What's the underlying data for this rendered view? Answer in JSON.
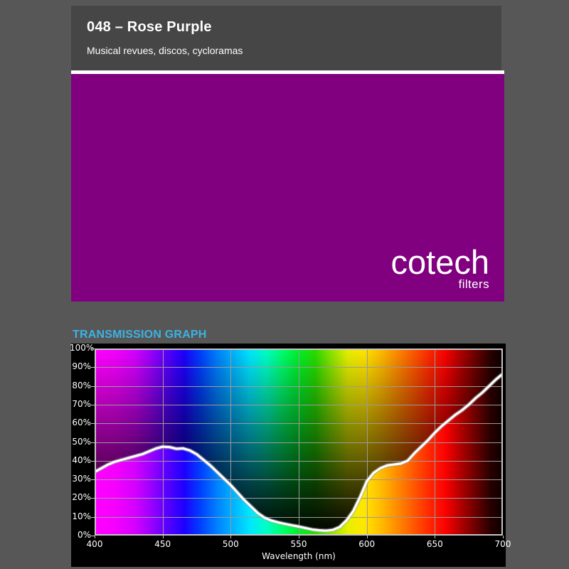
{
  "page": {
    "background": "#575757"
  },
  "header": {
    "background": "#464646",
    "title": "048 – Rose Purple",
    "subtitle": "Musical revues, discos, cycloramas"
  },
  "swatch": {
    "color": "#800080",
    "brand": "cotech",
    "brand_sub": "filters"
  },
  "section": {
    "heading": "TRANSMISSION GRAPH",
    "heading_color": "#3bb3e4"
  },
  "chart_data": {
    "type": "area",
    "title": "TRANSMISSION GRAPH",
    "xlabel": "Wavelength (nm)",
    "ylabel": "",
    "xlim": [
      400,
      700
    ],
    "ylim": [
      0,
      100
    ],
    "grid": true,
    "panel_bg": "#000000",
    "curve_color": "#ffffff",
    "grid_color": "#9b9b9b",
    "frame_color": "#c6c6c6",
    "x_ticks": [
      400,
      450,
      500,
      550,
      600,
      650,
      700
    ],
    "y_tick_values": [
      100,
      90,
      80,
      70,
      60,
      50,
      40,
      30,
      20,
      10,
      0
    ],
    "y_tick_labels": [
      "100%",
      "90%",
      "80%",
      "70%",
      "60%",
      "50%",
      "40%",
      "30%",
      "20%",
      "10%",
      "0%"
    ],
    "x": [
      400,
      405,
      410,
      415,
      420,
      425,
      430,
      435,
      440,
      445,
      450,
      455,
      460,
      465,
      470,
      475,
      480,
      485,
      490,
      495,
      500,
      505,
      510,
      515,
      520,
      525,
      530,
      535,
      540,
      545,
      550,
      555,
      560,
      565,
      570,
      575,
      580,
      585,
      590,
      595,
      600,
      605,
      610,
      615,
      620,
      625,
      630,
      635,
      640,
      645,
      650,
      655,
      660,
      665,
      670,
      675,
      680,
      685,
      690,
      695,
      700
    ],
    "transmission_percent": [
      34,
      36,
      38,
      39.5,
      40.5,
      41.5,
      42.5,
      43.5,
      45,
      46.5,
      47.5,
      47.3,
      46.4,
      46.6,
      45.5,
      43.5,
      40.5,
      37.5,
      34,
      30.5,
      27,
      23,
      19,
      15.5,
      12,
      9.5,
      8,
      7,
      6.2,
      5.5,
      4.8,
      4,
      3.2,
      2.8,
      2.6,
      3,
      4.5,
      8,
      13,
      20.5,
      29,
      33.5,
      36,
      37.5,
      38,
      38.5,
      40,
      44,
      47.5,
      51,
      55,
      58.5,
      61.5,
      64.5,
      67,
      70,
      73.5,
      76.5,
      80,
      83.5,
      86.5
    ],
    "spectrum_stops": [
      [
        0.0,
        "#ff00ff"
      ],
      [
        0.05,
        "#f600ff"
      ],
      [
        0.1,
        "#d400ff"
      ],
      [
        0.14,
        "#9900ff"
      ],
      [
        0.18,
        "#5500ff"
      ],
      [
        0.22,
        "#1c00ff"
      ],
      [
        0.26,
        "#0040ff"
      ],
      [
        0.3,
        "#0080ff"
      ],
      [
        0.34,
        "#00b4ff"
      ],
      [
        0.38,
        "#00e6ff"
      ],
      [
        0.42,
        "#00ffc8"
      ],
      [
        0.46,
        "#00ff6e"
      ],
      [
        0.5,
        "#00f02a"
      ],
      [
        0.54,
        "#28dc00"
      ],
      [
        0.58,
        "#8ce600"
      ],
      [
        0.62,
        "#e6f000"
      ],
      [
        0.66,
        "#ffe600"
      ],
      [
        0.7,
        "#ffbe00"
      ],
      [
        0.74,
        "#ff8c00"
      ],
      [
        0.78,
        "#ff5a00"
      ],
      [
        0.82,
        "#ff2800"
      ],
      [
        0.86,
        "#fa0000"
      ],
      [
        0.9,
        "#aa0000"
      ],
      [
        0.94,
        "#5f0000"
      ],
      [
        0.97,
        "#280000"
      ],
      [
        1.0,
        "#0d0000"
      ]
    ]
  }
}
